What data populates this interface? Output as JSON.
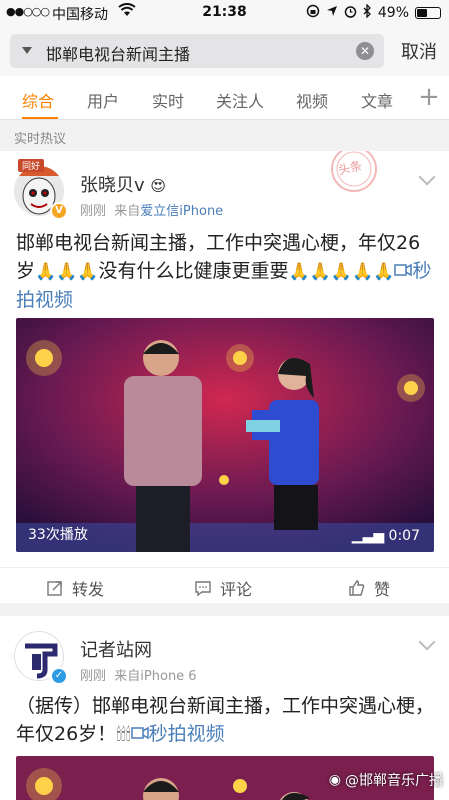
{
  "status_bar": {
    "signal": "●●○○○",
    "carrier": "中国移动",
    "time": "21:38",
    "battery": "49%",
    "battery_level": 0.49
  },
  "search": {
    "query": "邯郸电视台新闻主播",
    "cancel_label": "取消"
  },
  "tabs": [
    {
      "label": "综合",
      "active": true
    },
    {
      "label": "用户",
      "active": false
    },
    {
      "label": "实时",
      "active": false
    },
    {
      "label": "关注人",
      "active": false
    },
    {
      "label": "视频",
      "active": false
    },
    {
      "label": "文章",
      "active": false
    }
  ],
  "section_label": "实时热议",
  "posts": [
    {
      "user": "张晓贝v",
      "avatar_badge": "同好",
      "time": "刚刚",
      "source_prefix": "来自",
      "source": "爱立信iPhone",
      "stamp": "头条",
      "text": "邯郸电视台新闻主播，工作中突遇心梗，年仅26岁",
      "text_tail": "没有什么比健康更重要",
      "video_link": "秒拍视频",
      "video_plays": "33次播放",
      "video_duration": "0:07",
      "actions": {
        "repost": "转发",
        "comment": "评论",
        "like": "赞"
      }
    },
    {
      "user": "记者站网",
      "time": "刚刚",
      "source_prefix": "来自",
      "source": "iPhone 6",
      "text": "（据传）邯郸电视台新闻主播，工作中突遇心梗，年仅26岁！",
      "video_link": "秒拍视频"
    }
  ],
  "watermark": "@邯郸音乐广播"
}
